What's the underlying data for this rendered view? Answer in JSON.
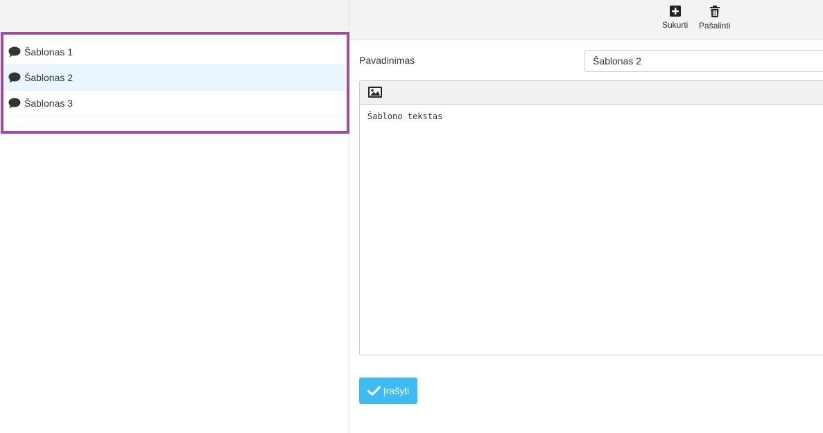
{
  "templates": {
    "items": [
      {
        "label": "Šablonas 1",
        "icon": "chat-bubble-icon"
      },
      {
        "label": "Šablonas 2",
        "icon": "chat-bubble-icon"
      },
      {
        "label": "Šablonas 3",
        "icon": "chat-bubble-icon"
      }
    ],
    "selected_index": 1
  },
  "toolbar": {
    "create_label": "Sukurti",
    "create_icon": "plus-square-icon",
    "delete_label": "Pašalinti",
    "delete_icon": "trash-icon"
  },
  "form": {
    "name_label": "Pavadinimas",
    "name_value": "Šablonas 2",
    "editor_image_icon": "image-icon",
    "editor_text": "Šablono tekstas",
    "save_label": "Įrašyti",
    "save_icon": "check-icon"
  },
  "colors": {
    "highlight_border": "#a04aa0",
    "selected_row": "#eaf6fd",
    "save_button": "#3cbcf2",
    "header_bg": "#f3f3f3"
  }
}
